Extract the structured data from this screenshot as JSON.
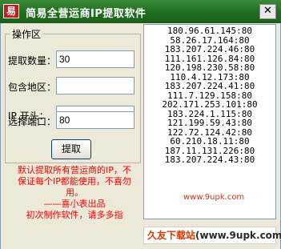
{
  "window": {
    "title": "简易全营运商IP提取软件",
    "icon_glyph": "易",
    "close_glyph": "✕"
  },
  "group": {
    "title": "操作区",
    "fields": [
      {
        "label": "提取数量：",
        "value": "30"
      },
      {
        "label": "包含地区：",
        "value": ""
      },
      {
        "label": "IP 开头：",
        "value": ""
      },
      {
        "label": "选择端口：",
        "value": "80"
      }
    ],
    "button_label": "提取"
  },
  "note": {
    "lines": [
      "默认提取所有营运商的IP，不",
      "保证每个IP都能使用，不喜勿",
      "用。",
      "——喜小表出品",
      "初次制作软件，请多多指"
    ]
  },
  "ip_list": [
    "180.96.61.145:80",
    "58.26.17.164:80",
    "183.207.224.46:80",
    "111.161.126.84:80",
    "120.198.230.58:80",
    "110.4.12.173:80",
    "183.207.224.41:80",
    "111.7.129.158:80",
    "202.171.253.101:80",
    "183.224.1.115:80",
    "121.199.59.43:80",
    "122.72.124.42:80",
    "60.210.18.11:80",
    "187.11.131.226:80",
    "183.207.224.43:80"
  ],
  "watermark": "www.9upk.com",
  "footer": {
    "left": "久友下载站",
    "right": "(www.9upk.com)"
  },
  "colors": {
    "titlebar": "#1f6e1f",
    "note_text": "#ff0000",
    "footer_brand": "#d93a00"
  }
}
